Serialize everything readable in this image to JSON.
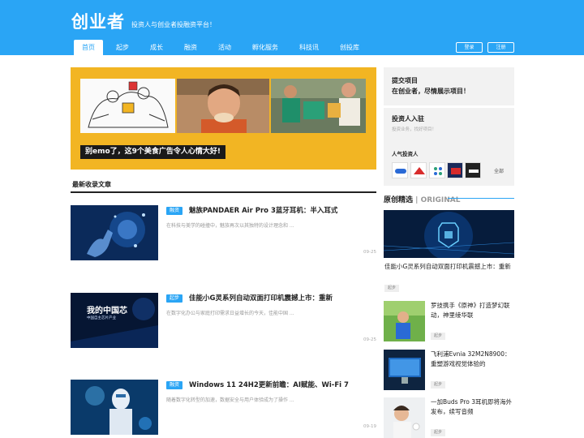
{
  "header": {
    "logo": "创业者",
    "slogan": "投资人与创业者投融资平台！",
    "login": "登录",
    "register": "注册"
  },
  "nav": [
    "首页",
    "起步",
    "成长",
    "融资",
    "活动",
    "孵化服务",
    "科技讯",
    "创投库"
  ],
  "banner": {
    "caption": "别emo了，这9个美食广告令人心情大好!"
  },
  "section": {
    "title": "最新收录文章"
  },
  "articles": [
    {
      "tag": "融资",
      "title": "魅族PANDAER Air Pro 3蓝牙耳机：半入耳式",
      "summary": "在科技与美学的碰撞中，魅族再次以其独特的设计理念和 ...",
      "date": "09-25"
    },
    {
      "tag": "起步",
      "title": "佳能小G灵系列自动双面打印机震撼上市：重新",
      "summary": "在数字化办公与家庭打印需求日益增长的今天，佳能中国 ...",
      "date": "09-25",
      "thumb_text": "我的中国芯",
      "thumb_sub": "中国自主芯片产业"
    },
    {
      "tag": "融资",
      "title": "Windows 11 24H2更新前瞻：AI赋能、Wi-Fi 7",
      "summary": "随着数字化转型的加速，数据安全与用户体验成为了操作 ...",
      "date": "09-19"
    }
  ],
  "sidebar": {
    "submit_title": "提交项目",
    "submit_sub": "在创业者，尽情展示项目！",
    "investor_title": "投资人入驻",
    "investor_sub": "投资业务，找好项目！",
    "investors_label": "人气投资人",
    "all": "全部"
  },
  "original": {
    "title": "原创精选",
    "subtitle": "ORIGINAL",
    "feature": {
      "title": "佳能小G灵系列自动双面打印机震撼上市：重新",
      "tag": "起步"
    },
    "items": [
      {
        "title": "罗技携手《原神》打造梦幻联动，神里绫华联",
        "tag": "起步"
      },
      {
        "title": "飞利浦Evnia 32M2N8900：重塑游戏视觉体验的",
        "tag": "起步"
      },
      {
        "title": "一加Buds Pro 3耳机即将海外发布，续写音频",
        "tag": "起步"
      }
    ]
  }
}
